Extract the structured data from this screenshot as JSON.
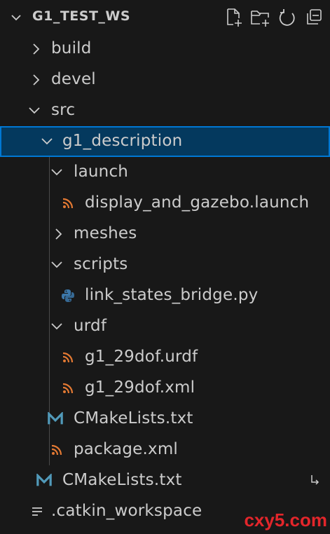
{
  "explorer": {
    "title": "G1_TEST_WS",
    "actions": [
      {
        "icon": "new-file-icon"
      },
      {
        "icon": "new-folder-icon"
      },
      {
        "icon": "refresh-icon"
      },
      {
        "icon": "collapse-all-icon"
      }
    ]
  },
  "tree": [
    {
      "label": "build",
      "type": "folder",
      "expanded": false
    },
    {
      "label": "devel",
      "type": "folder",
      "expanded": false
    },
    {
      "label": "src",
      "type": "folder",
      "expanded": true
    },
    {
      "label": "g1_description",
      "type": "folder",
      "expanded": true,
      "selected": true
    },
    {
      "label": "launch",
      "type": "folder",
      "expanded": true
    },
    {
      "label": "display_and_gazebo.launch",
      "type": "file",
      "icon": "rss-icon"
    },
    {
      "label": "meshes",
      "type": "folder",
      "expanded": false
    },
    {
      "label": "scripts",
      "type": "folder",
      "expanded": true
    },
    {
      "label": "link_states_bridge.py",
      "type": "file",
      "icon": "python-icon"
    },
    {
      "label": "urdf",
      "type": "folder",
      "expanded": true
    },
    {
      "label": "g1_29dof.urdf",
      "type": "file",
      "icon": "rss-icon"
    },
    {
      "label": "g1_29dof.xml",
      "type": "file",
      "icon": "rss-icon"
    },
    {
      "label": "CMakeLists.txt",
      "type": "file",
      "icon": "cmake-m-icon"
    },
    {
      "label": "package.xml",
      "type": "file",
      "icon": "rss-icon"
    },
    {
      "label": "CMakeLists.txt",
      "type": "file",
      "icon": "cmake-m-icon"
    },
    {
      "label": ".catkin_workspace",
      "type": "file",
      "icon": "lines-icon"
    }
  ],
  "watermark": "cxy5.com",
  "colors": {
    "background": "#181818",
    "selection_bg": "#04395e",
    "selection_border": "#0078d4",
    "rss_orange": "#e37933",
    "cmake_blue": "#519aba",
    "python_blue": "#3c78aa",
    "python_yellow": "#ffd43b"
  }
}
